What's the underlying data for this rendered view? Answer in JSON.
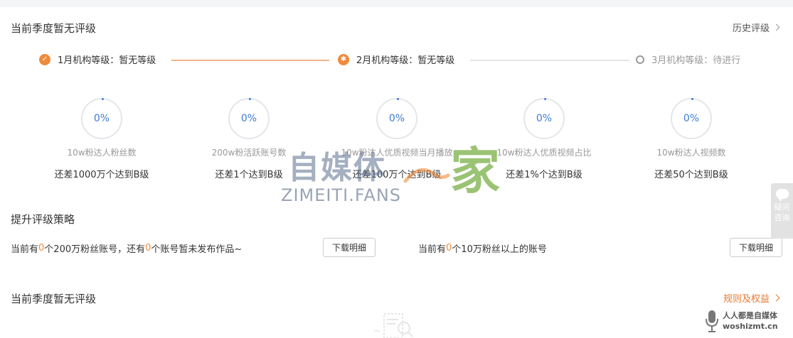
{
  "header": {
    "title": "当前季度暂无评级",
    "history_link": "历史评级"
  },
  "steps": [
    {
      "label": "1月机构等级：暂无等级",
      "state": "done"
    },
    {
      "label": "2月机构等级：暂无等级",
      "state": "active"
    },
    {
      "label": "3月机构等级：待进行",
      "state": "pending"
    }
  ],
  "metrics": [
    {
      "percent": "0%",
      "label": "10w粉达人粉丝数",
      "gap": "还差1000万个达到B级"
    },
    {
      "percent": "0%",
      "label": "200w粉活跃账号数",
      "gap": "还差1个达到B级"
    },
    {
      "percent": "0%",
      "label": "10w粉达人优质视频当月播放",
      "gap": "还差100万个达到B级"
    },
    {
      "percent": "0%",
      "label": "10w粉达人优质视频占比",
      "gap": "还差1%个达到B级"
    },
    {
      "percent": "0%",
      "label": "10w粉达人视频数",
      "gap": "还差50个达到B级"
    }
  ],
  "strategy": {
    "title": "提升评级策略",
    "row1": {
      "prefix": "当前有",
      "count1": "0",
      "mid": "个200万粉丝账号，还有",
      "count2": "0",
      "suffix": "个账号暂未发布作品~",
      "button": "下载明细"
    },
    "row2": {
      "prefix": "当前有",
      "count": "0",
      "suffix": "个10万粉丝以上的账号",
      "button": "下载明细"
    }
  },
  "footer": {
    "title": "当前季度暂无评级",
    "rules_link": "规则及权益"
  },
  "side_float": {
    "line1": "疑问",
    "line2": "咨询"
  },
  "watermark": {
    "text": "自媒体",
    "connector": "之",
    "home": "家",
    "domain": "ZIMEITI.FANS"
  },
  "corner_watermark": {
    "line1": "人人都是自媒体",
    "line2": "woshizmt.cn"
  },
  "colors": {
    "accent": "#f08a3c",
    "ring": "#3e7bd6",
    "pending": "#999999"
  }
}
